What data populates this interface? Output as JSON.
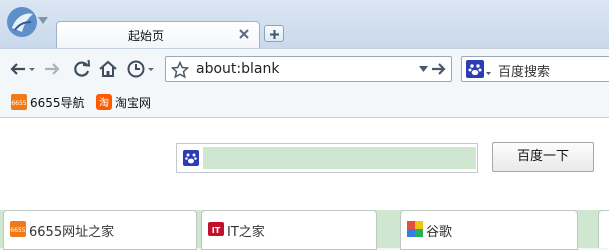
{
  "tab": {
    "title": "起始页"
  },
  "address_bar": {
    "value": "about:blank"
  },
  "search_bar": {
    "engine_icon": "baidu-paw-icon",
    "placeholder": "百度搜索"
  },
  "bookmarks": [
    {
      "label": "6655导航",
      "icon": "6655-icon"
    },
    {
      "label": "淘宝网",
      "icon": "taobao-icon"
    }
  ],
  "page_search": {
    "value": "",
    "button_label": "百度一下"
  },
  "quick_links": [
    {
      "label": "6655网址之家",
      "icon": "6655-icon"
    },
    {
      "label": "IT之家",
      "icon": "ithome-icon"
    },
    {
      "label": "谷歌",
      "icon": "google-icon"
    }
  ],
  "colors": {
    "accent_green": "#cfe6d0",
    "chrome_blue": "#c9d9ec"
  }
}
